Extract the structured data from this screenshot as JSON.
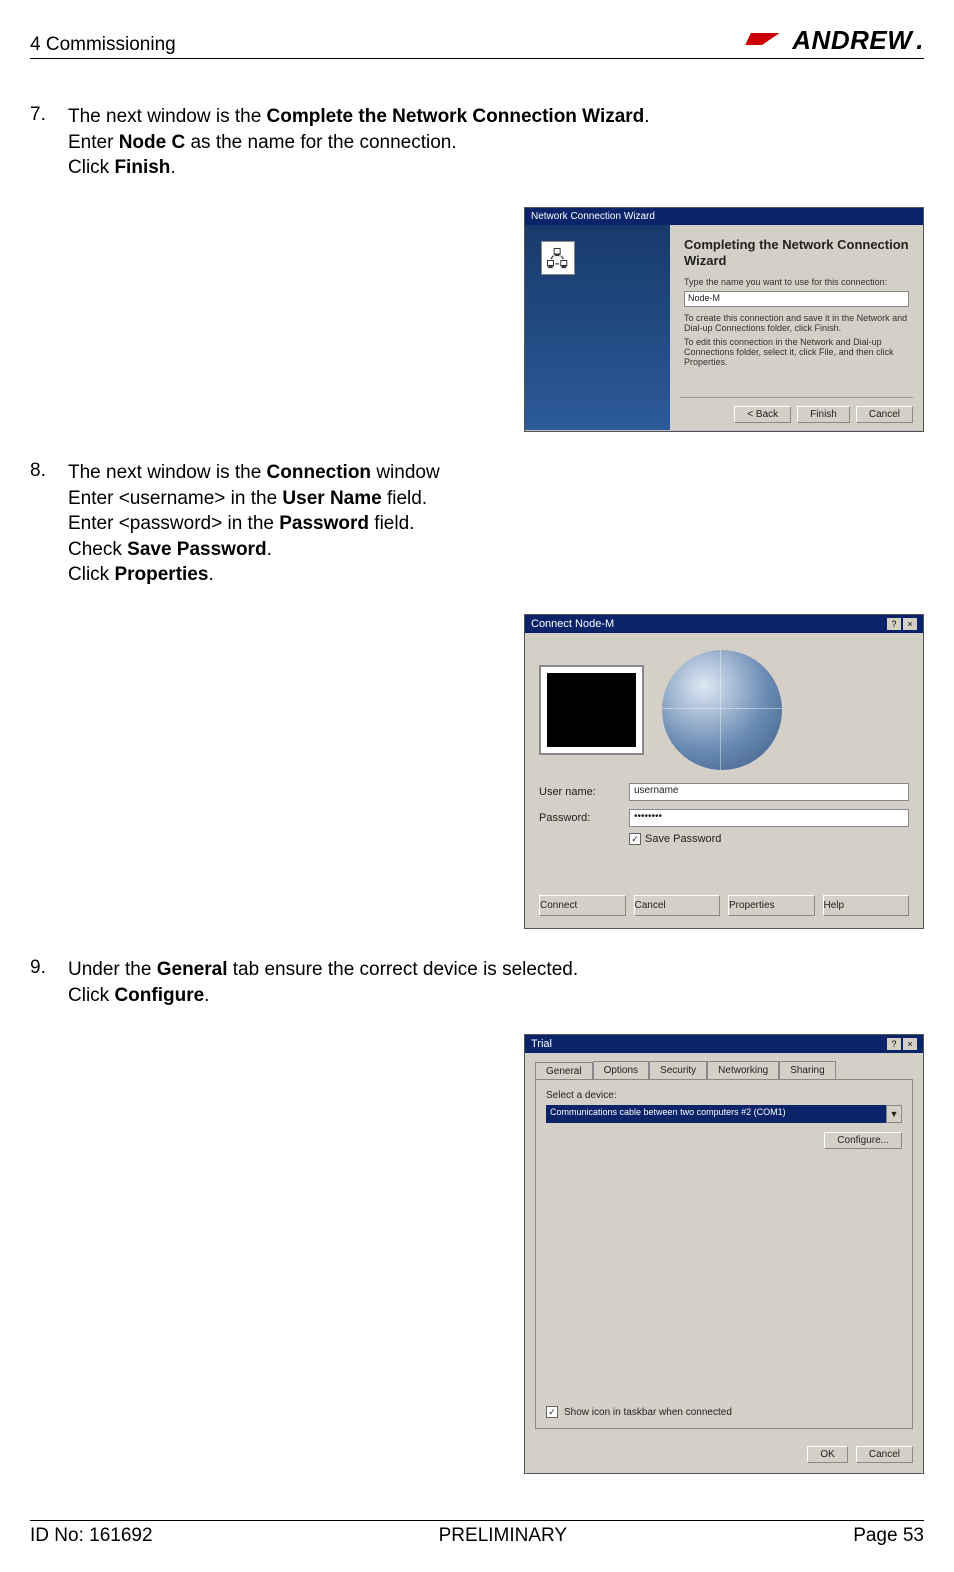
{
  "header": {
    "section": "4 Commissioning",
    "brand": "ANDREW"
  },
  "steps": [
    {
      "num": "7.",
      "line1": {
        "pre": "The next window is the ",
        "bold": "Complete the Network Connection Wizard",
        "post": "."
      },
      "line2": {
        "pre": "Enter ",
        "bold": "Node C",
        "post": " as the name for the connection."
      },
      "line3": {
        "pre": "Click ",
        "bold": "Finish",
        "post": "."
      }
    },
    {
      "num": "8.",
      "line1": {
        "pre": "The next window is the ",
        "bold": "Connection",
        "post": " window"
      },
      "line2": {
        "pre": "Enter <username> in the ",
        "bold": "User Name",
        "post": " field."
      },
      "line3": {
        "pre": "Enter <password> in the ",
        "bold": "Password",
        "post": " field."
      },
      "line4": {
        "pre": "Check ",
        "bold": "Save Password",
        "post": "."
      },
      "line5": {
        "pre": "Click ",
        "bold": "Properties",
        "post": "."
      }
    },
    {
      "num": "9.",
      "line1": {
        "pre": "Under the ",
        "bold": "General",
        "post": " tab ensure the correct device is selected."
      },
      "line2": {
        "pre": "Click ",
        "bold": "Configure",
        "post": "."
      }
    }
  ],
  "fig1": {
    "titlebar": "Network Connection Wizard",
    "heading": "Completing the Network Connection Wizard",
    "desc1": "Type the name you want to use for this connection:",
    "input_value": "Node-M",
    "desc2": "To create this connection and save it in the Network and Dial-up Connections folder, click Finish.",
    "desc3": "To edit this connection in the Network and Dial-up Connections folder, select it, click File, and then click Properties.",
    "buttons": {
      "back": "< Back",
      "finish": "Finish",
      "cancel": "Cancel"
    }
  },
  "fig2": {
    "titlebar": "Connect Node-M",
    "labels": {
      "user": "User name:",
      "pass": "Password:",
      "save": "Save Password"
    },
    "values": {
      "user": "username",
      "pass": "••••••••"
    },
    "buttons": {
      "connect": "Connect",
      "cancel": "Cancel",
      "properties": "Properties",
      "help": "Help"
    }
  },
  "fig3": {
    "titlebar": "Trial",
    "tabs": [
      "General",
      "Options",
      "Security",
      "Networking",
      "Sharing"
    ],
    "select_label": "Select a device:",
    "device": "Communications cable between two computers #2 (COM1)",
    "configure": "Configure...",
    "show_icon": "Show icon in taskbar when connected",
    "buttons": {
      "ok": "OK",
      "cancel": "Cancel"
    }
  },
  "footer": {
    "left": "ID No: 161692",
    "center": "PRELIMINARY",
    "right": "Page 53"
  }
}
